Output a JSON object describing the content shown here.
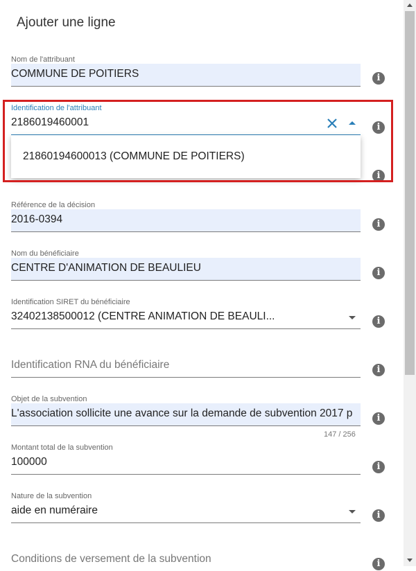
{
  "dialog": {
    "title": "Ajouter une ligne"
  },
  "fields": {
    "nom_attribuant": {
      "label": "Nom de l'attribuant",
      "value": "COMMUNE DE POITIERS"
    },
    "id_attribuant": {
      "label": "Identification de l'attribuant",
      "value": "2186019460001"
    },
    "reference_decision": {
      "label": "Référence de la décision",
      "value": "2016-0394"
    },
    "nom_beneficiaire": {
      "label": "Nom du bénéficiaire",
      "value": "CENTRE D'ANIMATION DE BEAULIEU"
    },
    "siret_beneficiaire": {
      "label": "Identification SIRET du bénéficiaire",
      "value": "32402138500012 (CENTRE ANIMATION DE BEAULI..."
    },
    "rna_beneficiaire": {
      "placeholder": "Identification RNA du bénéficiaire"
    },
    "objet_subvention": {
      "label": "Objet de la subvention",
      "value": "L'association sollicite une avance sur la demande de subvention 2017 p",
      "counter": "147 / 256"
    },
    "montant_total": {
      "label": "Montant total de la subvention",
      "value": "100000"
    },
    "nature_subvention": {
      "label": "Nature de la subvention",
      "value": "aide en numéraire"
    },
    "conditions_versement": {
      "placeholder": "Conditions de versement de la subvention"
    }
  },
  "dropdown": {
    "option": "21860194600013 (COMMUNE DE POITIERS)"
  },
  "icons": {
    "info": "info-icon",
    "clear": "close-icon",
    "toggle": "caret-icon"
  },
  "colors": {
    "field_fill": "#e8effc",
    "accent": "#2a7fb8",
    "highlight": "#d42020"
  }
}
